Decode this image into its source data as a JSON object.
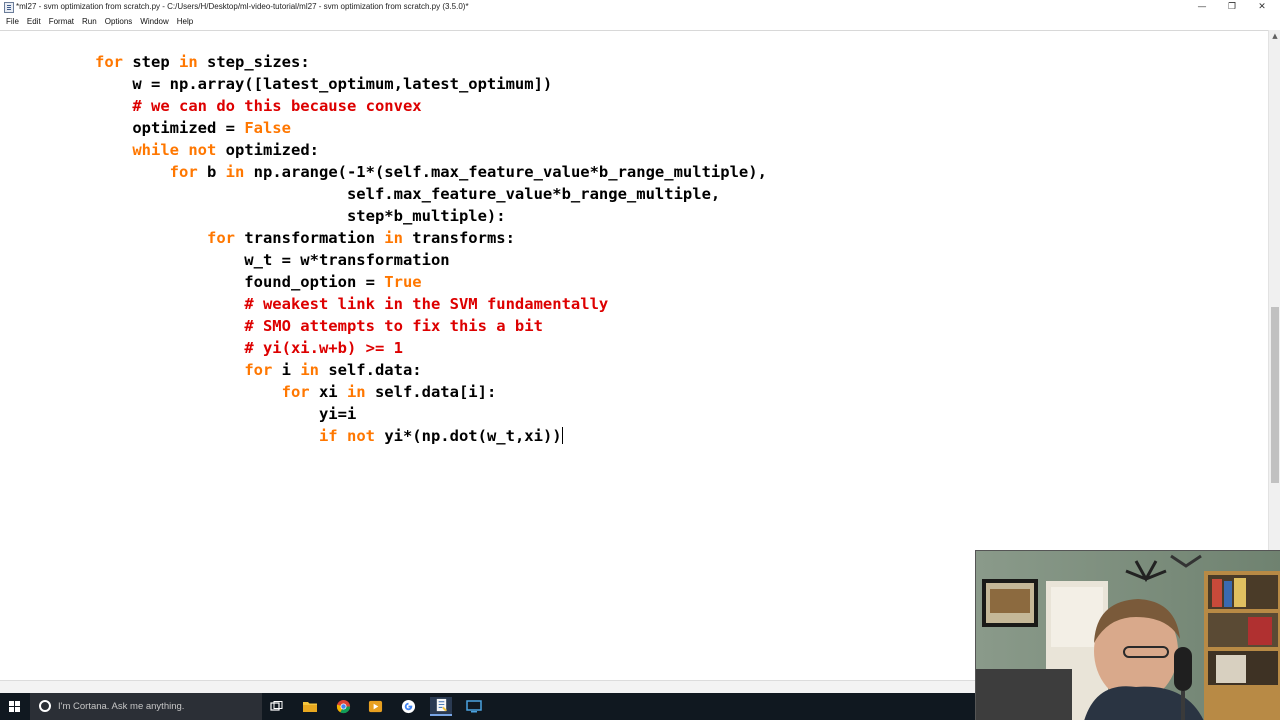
{
  "window": {
    "title": "*ml27 - svm optimization from scratch.py - C:/Users/H/Desktop/ml-video-tutorial/ml27 - svm optimization from scratch.py (3.5.0)*",
    "minimize_glyph": "—",
    "maximize_glyph": "❐",
    "close_glyph": "✕"
  },
  "menu": {
    "items": [
      {
        "label": "File"
      },
      {
        "label": "Edit"
      },
      {
        "label": "Format"
      },
      {
        "label": "Run"
      },
      {
        "label": "Options"
      },
      {
        "label": "Window"
      },
      {
        "label": "Help"
      }
    ]
  },
  "editor": {
    "lines": [
      [
        [
          "kw",
          "for"
        ],
        [
          "t",
          " step "
        ],
        [
          "kw",
          "in"
        ],
        [
          "t",
          " step_sizes:"
        ]
      ],
      [
        [
          "t",
          "    w = np.array([latest_optimum,latest_optimum])"
        ]
      ],
      [
        [
          "t",
          "    "
        ],
        [
          "cm",
          "# we can do this because convex"
        ]
      ],
      [
        [
          "t",
          "    optimized = "
        ],
        [
          "kw",
          "False"
        ]
      ],
      [
        [
          "t",
          "    "
        ],
        [
          "kw",
          "while"
        ],
        [
          "t",
          " "
        ],
        [
          "kw",
          "not"
        ],
        [
          "t",
          " optimized:"
        ]
      ],
      [
        [
          "t",
          "        "
        ],
        [
          "kw",
          "for"
        ],
        [
          "t",
          " b "
        ],
        [
          "kw",
          "in"
        ],
        [
          "t",
          " np.arange(-1*(self.max_feature_value*b_range_multiple),"
        ]
      ],
      [
        [
          "t",
          "                           self.max_feature_value*b_range_multiple,"
        ]
      ],
      [
        [
          "t",
          "                           step*b_multiple):"
        ]
      ],
      [
        [
          "t",
          "            "
        ],
        [
          "kw",
          "for"
        ],
        [
          "t",
          " transformation "
        ],
        [
          "kw",
          "in"
        ],
        [
          "t",
          " transforms:"
        ]
      ],
      [
        [
          "t",
          "                w_t = w*transformation"
        ]
      ],
      [
        [
          "t",
          "                found_option = "
        ],
        [
          "kw",
          "True"
        ]
      ],
      [
        [
          "t",
          "                "
        ],
        [
          "cm",
          "# weakest link in the SVM fundamentally"
        ]
      ],
      [
        [
          "t",
          "                "
        ],
        [
          "cm",
          "# SMO attempts to fix this a bit"
        ]
      ],
      [
        [
          "t",
          "                "
        ],
        [
          "cm",
          "# yi(xi.w+b) >= 1"
        ]
      ],
      [
        [
          "t",
          "                "
        ],
        [
          "kw",
          "for"
        ],
        [
          "t",
          " i "
        ],
        [
          "kw",
          "in"
        ],
        [
          "t",
          " self.data:"
        ]
      ],
      [
        [
          "t",
          "                    "
        ],
        [
          "kw",
          "for"
        ],
        [
          "t",
          " xi "
        ],
        [
          "kw",
          "in"
        ],
        [
          "t",
          " self.data[i]:"
        ]
      ],
      [
        [
          "t",
          "                        yi=i"
        ]
      ],
      [
        [
          "t",
          "                        "
        ],
        [
          "kw",
          "if"
        ],
        [
          "t",
          " "
        ],
        [
          "kw",
          "not"
        ],
        [
          "t",
          " yi*(np.dot(w_t,xi))"
        ]
      ]
    ]
  },
  "taskbar": {
    "search_placeholder": "I'm Cortana. Ask me anything.",
    "icons": [
      {
        "name": "task-view-icon",
        "active": false
      },
      {
        "name": "file-explorer-icon",
        "active": false
      },
      {
        "name": "chrome-icon",
        "active": false
      },
      {
        "name": "media-player-icon",
        "active": false
      },
      {
        "name": "google-icon",
        "active": false
      },
      {
        "name": "python-idle-icon",
        "active": true
      },
      {
        "name": "screen-recorder-icon",
        "active": false
      }
    ]
  },
  "colors": {
    "keyword": "#ff7700",
    "comment": "#dd0000",
    "builtin": "#900090",
    "text": "#000000",
    "taskbar": "#101820"
  }
}
